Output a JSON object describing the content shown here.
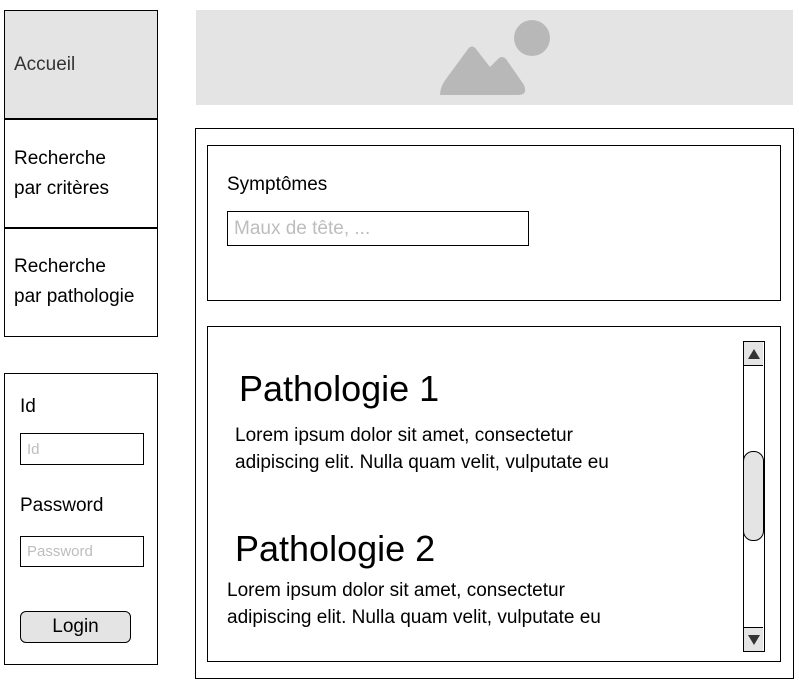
{
  "nav": {
    "items": [
      {
        "label": "Accueil"
      },
      {
        "label": "Recherche\npar critères"
      },
      {
        "label": "Recherche\npar pathologie"
      }
    ]
  },
  "login": {
    "id_label": "Id",
    "id_placeholder": "Id",
    "password_label": "Password",
    "password_placeholder": "Password",
    "login_label": "Login"
  },
  "banner": {
    "icon": "image-placeholder-icon",
    "color": "#e4e4e4",
    "icon_color": "#b8b8b8"
  },
  "search": {
    "label": "Symptômes",
    "placeholder": "Maux de tête, ..."
  },
  "results": [
    {
      "title": "Pathologie 1",
      "description": "Lorem ipsum dolor sit amet, consectetur\nadipiscing elit. Nulla quam velit, vulputate eu"
    },
    {
      "title": "Pathologie 2",
      "description": "Lorem ipsum dolor sit amet, consectetur\nadipiscing elit. Nulla quam velit, vulputate eu"
    }
  ],
  "scrollbar": {
    "up_icon": "arrow-up-icon",
    "down_icon": "arrow-down-icon"
  }
}
